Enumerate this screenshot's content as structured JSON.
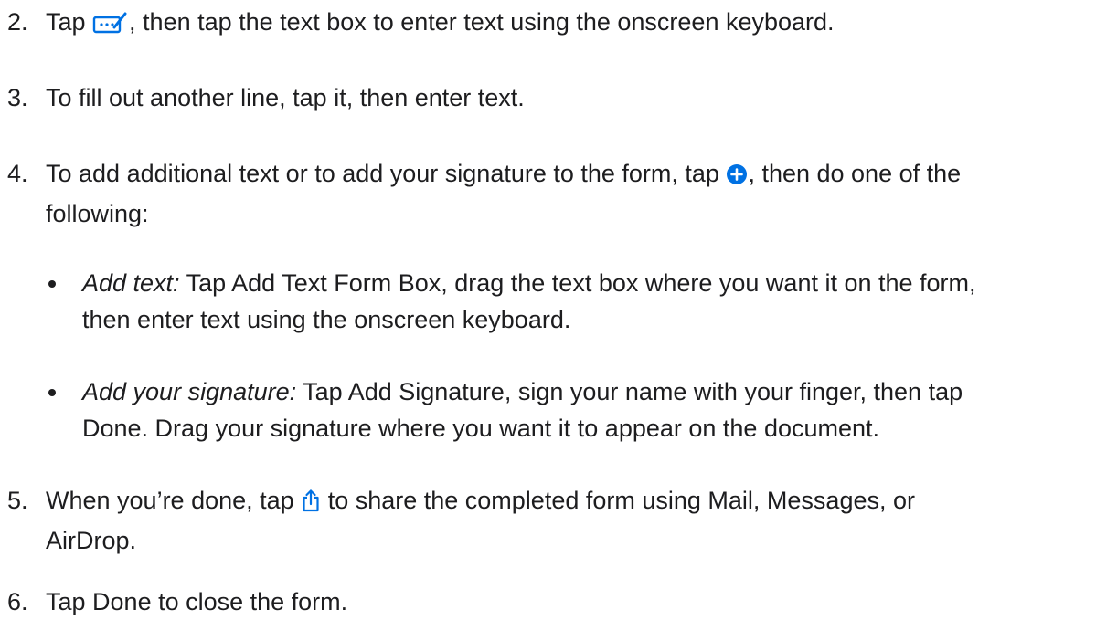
{
  "steps": [
    {
      "number": "2.",
      "before_icon": "Tap ",
      "icon": "markup-icon",
      "after_icon": ", then tap the text box to enter text using the onscreen keyboard."
    },
    {
      "number": "3.",
      "text": "To fill out another line, tap it, then enter text."
    },
    {
      "number": "4.",
      "before_icon": "To add additional text or to add your signature to the form, tap ",
      "icon": "add-circle-icon",
      "after_icon": ", then do one of the",
      "continuation": "following:"
    },
    {
      "number": "5.",
      "before_icon": "When you’re done, tap ",
      "icon": "share-icon",
      "after_icon": " to share the completed form using Mail, Messages, or",
      "continuation": "AirDrop."
    },
    {
      "number": "6.",
      "text": "Tap Done to close the form."
    }
  ],
  "bullets": [
    {
      "term": "Add text:",
      "line1": " Tap Add Text Form Box, drag the text box where you want it on the form,",
      "line2": "then enter text using the onscreen keyboard."
    },
    {
      "term": "Add your signature:",
      "line1": " Tap Add Signature, sign your name with your finger, then tap",
      "line2": "Done. Drag your signature where you want it to appear on the document."
    }
  ],
  "colors": {
    "text": "#1d1d1f",
    "accent": "#0071e3"
  }
}
